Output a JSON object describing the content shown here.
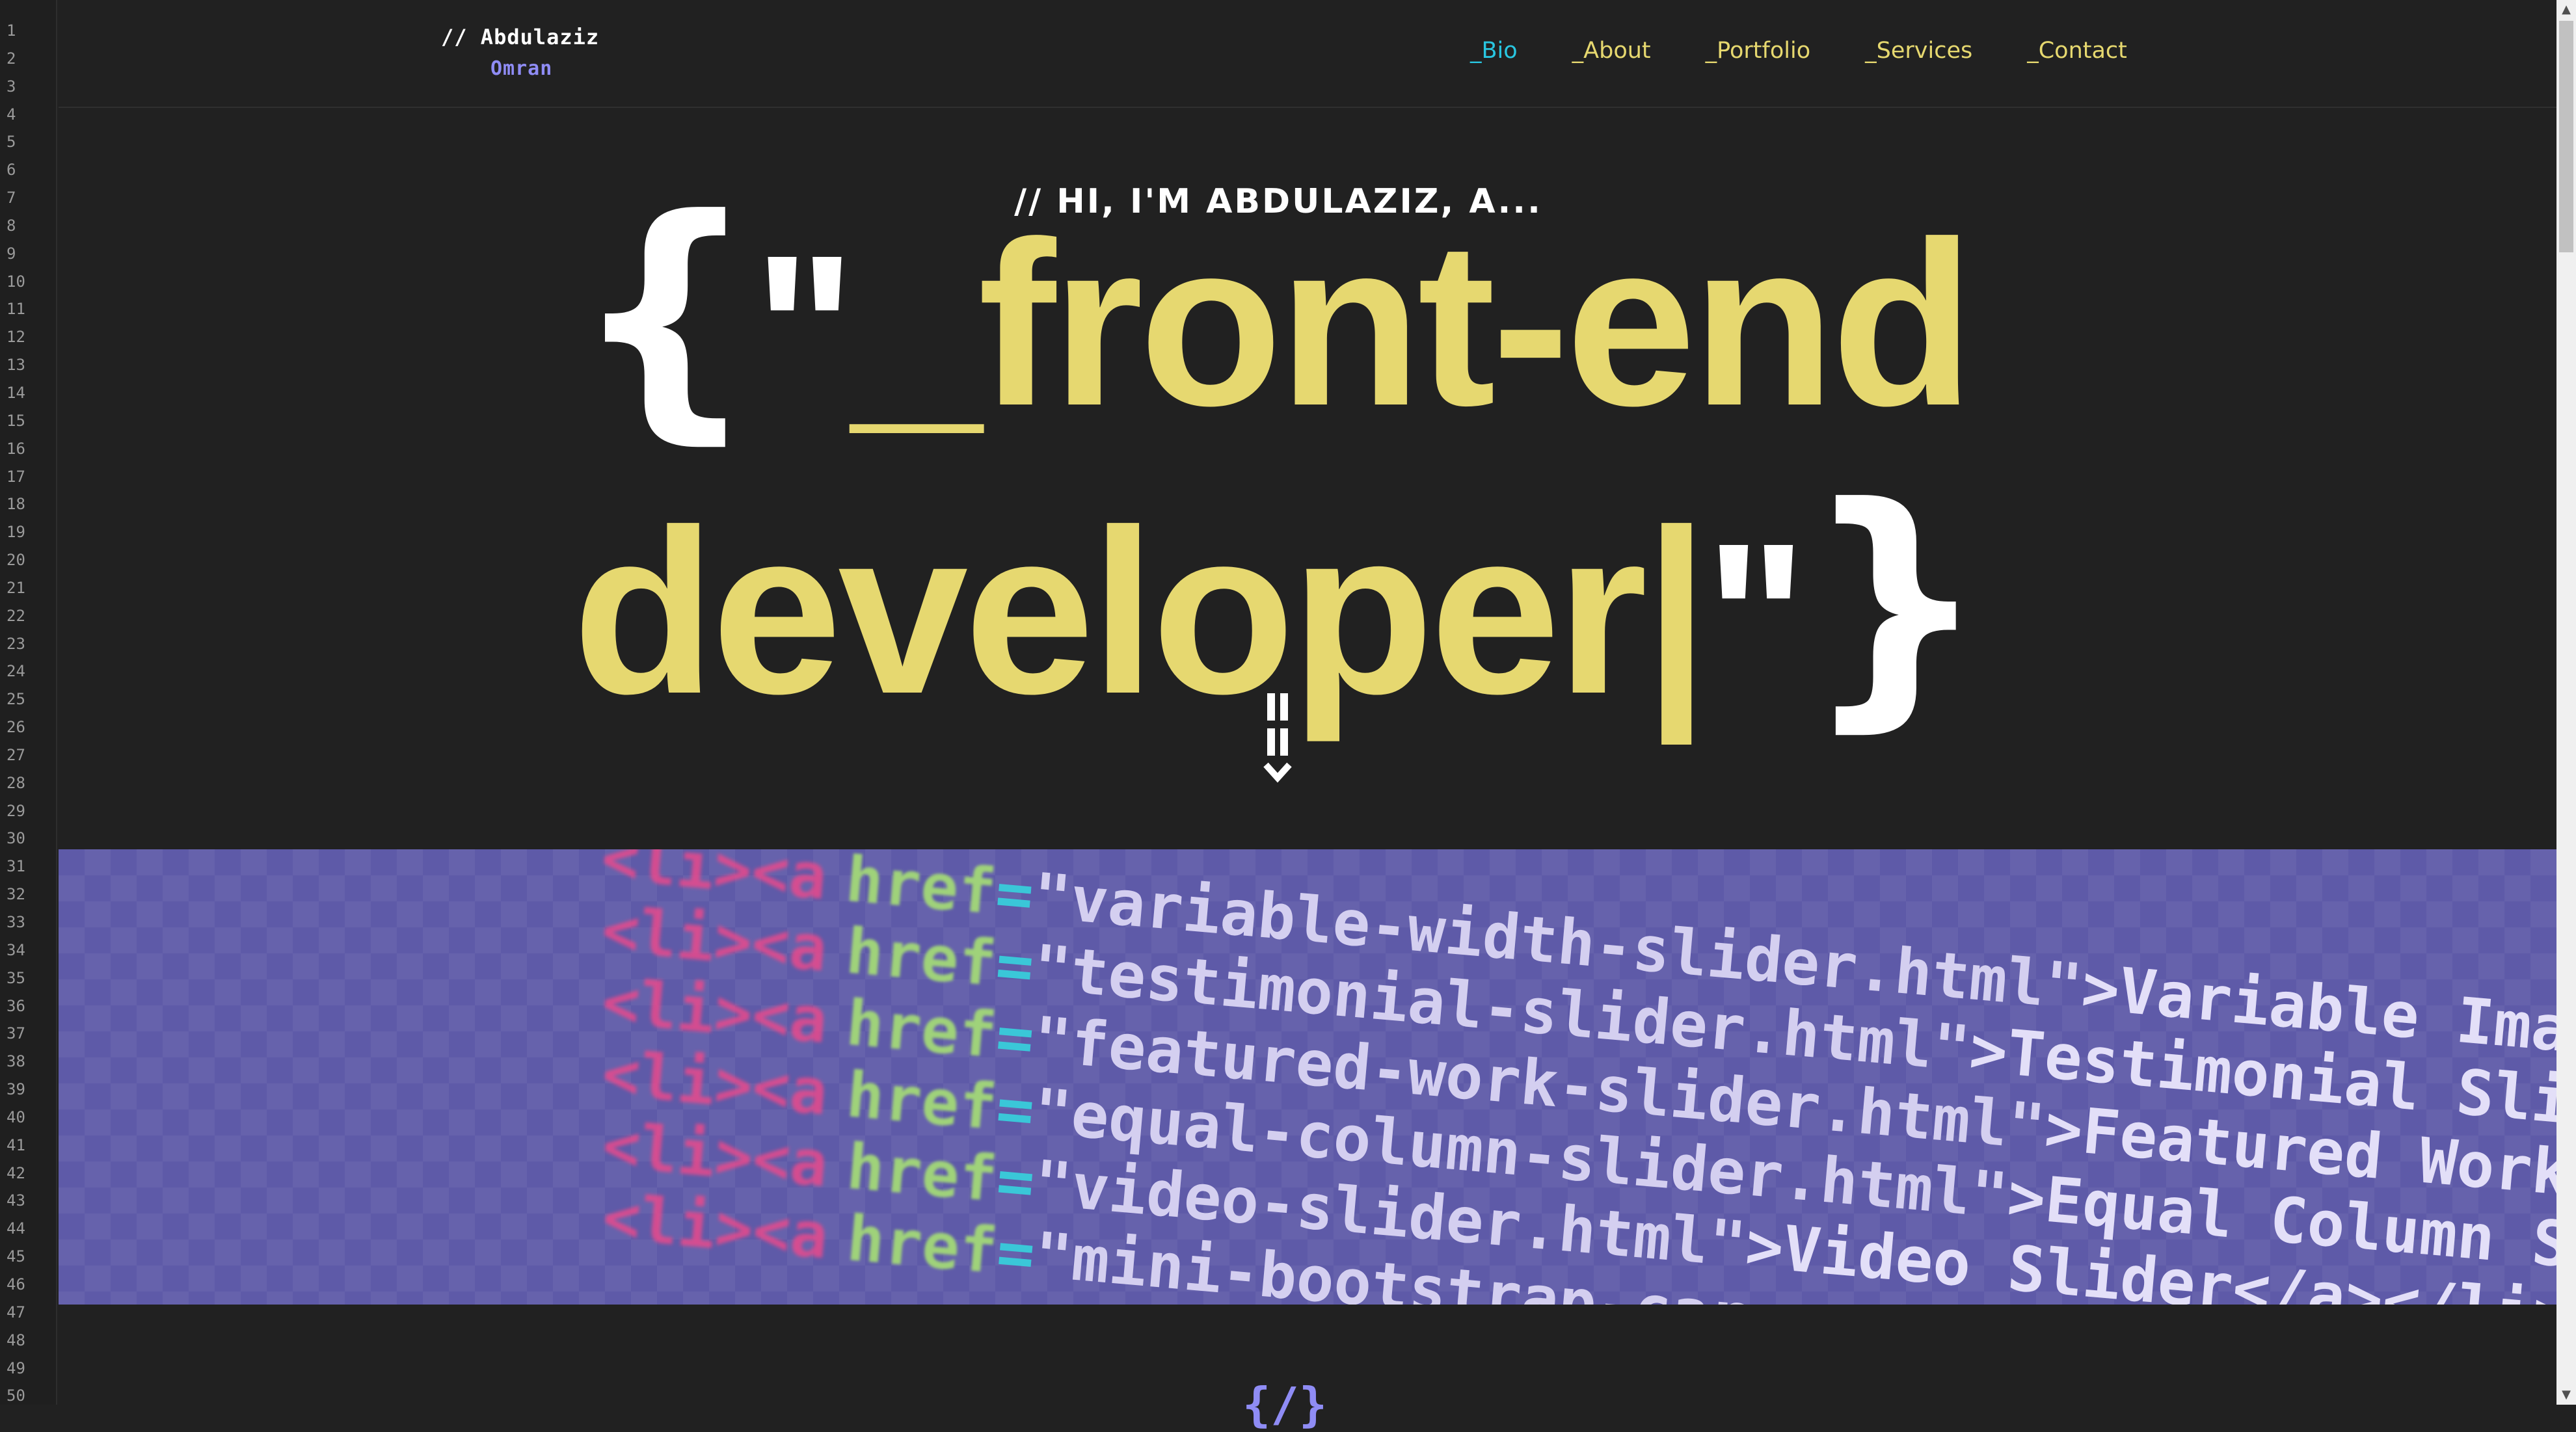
{
  "gutter": {
    "line_numbers": [
      "1",
      "2",
      "3",
      "4",
      "5",
      "6",
      "7",
      "8",
      "9",
      "10",
      "11",
      "12",
      "13",
      "14",
      "15",
      "16",
      "17",
      "18",
      "19",
      "20",
      "21",
      "22",
      "23",
      "24",
      "25",
      "26",
      "27",
      "28",
      "29",
      "30",
      "31",
      "32",
      "33",
      "34",
      "35",
      "36",
      "37",
      "38",
      "39",
      "40",
      "41",
      "42",
      "43",
      "44",
      "45",
      "46",
      "47",
      "48",
      "49",
      "50"
    ]
  },
  "brand": {
    "line1": "// Abdulaziz",
    "line2": "Omran"
  },
  "nav": {
    "items": [
      {
        "label": "_Bio",
        "active": true
      },
      {
        "label": "_About",
        "active": false
      },
      {
        "label": "_Portfolio",
        "active": false
      },
      {
        "label": "_Services",
        "active": false
      },
      {
        "label": "_Contact",
        "active": false
      }
    ]
  },
  "hero": {
    "intro": "// HI, I'M ABDULAZIZ, A...",
    "open_brace": "{",
    "open_quote": "\"",
    "line1": "_front-end",
    "line2": "developer",
    "cursor": "|",
    "close_quote": "\"",
    "close_brace": "}"
  },
  "banner": {
    "code_lines": [
      {
        "tag": "<li><a",
        "attr": "href",
        "value": "\"variable-width-slider.html\"",
        "text": ">Variable Image Wi"
      },
      {
        "tag": "<li><a",
        "attr": "href",
        "value": "\"testimonial-slider.html\"",
        "text": ">Testimonial Slider</"
      },
      {
        "tag": "<li><a",
        "attr": "href",
        "value": "\"featured-work-slider.html\"",
        "text": ">Featured Work Sli"
      },
      {
        "tag": "<li><a",
        "attr": "href",
        "value": "\"equal-column-slider.html\"",
        "text": ">Equal Column Slid"
      },
      {
        "tag": "<li><a",
        "attr": "href",
        "value": "\"video-slider.html\"",
        "text": ">Video Slider</a></li>"
      },
      {
        "tag": "<li><a",
        "attr": "href",
        "value": "\"mini-bootstrap-carousel.html\"",
        "text": ">"
      }
    ]
  },
  "footer": {
    "glyph": "{/}"
  },
  "colors": {
    "background": "#212121",
    "accent_yellow": "#e6d870",
    "accent_cyan": "#29c6e0",
    "accent_purple": "#8f8cf5",
    "banner": "#5e5aa8"
  },
  "icons": {
    "scroll": "scroll-down-icon",
    "scroll_up": "scroll-up-arrow-icon",
    "scroll_down": "scroll-down-arrow-icon"
  }
}
